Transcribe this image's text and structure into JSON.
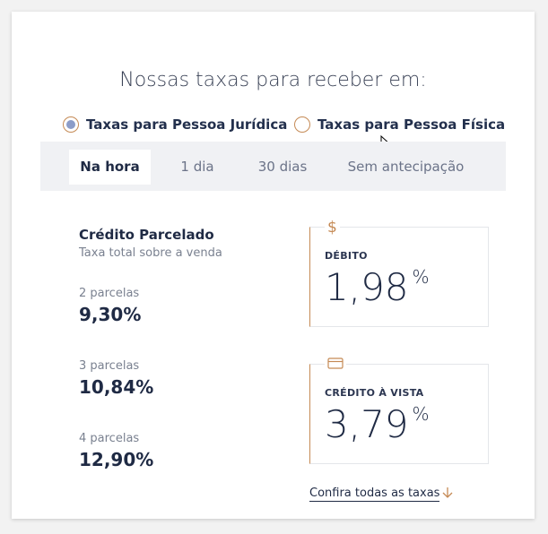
{
  "heading": "Nossas taxas para receber em:",
  "person_type": {
    "options": [
      {
        "label": "Taxas para Pessoa Jurídica",
        "selected": true
      },
      {
        "label": "Taxas para Pessoa Física",
        "selected": false
      }
    ]
  },
  "tabs": [
    {
      "label": "Na hora",
      "active": true
    },
    {
      "label": "1 dia",
      "active": false
    },
    {
      "label": "30 dias",
      "active": false
    },
    {
      "label": "Sem antecipação",
      "active": false
    }
  ],
  "credit_installments": {
    "title": "Crédito Parcelado",
    "subtitle": "Taxa total sobre a venda",
    "items": [
      {
        "label": "2 parcelas",
        "value": "9,30%"
      },
      {
        "label": "3 parcelas",
        "value": "10,84%"
      },
      {
        "label": "4 parcelas",
        "value": "12,90%"
      }
    ]
  },
  "debit": {
    "caption": "DÉBITO",
    "rate": "1,98",
    "unit": "%",
    "icon": "dollar-icon"
  },
  "credit_cash": {
    "caption": "CRÉDITO À VISTA",
    "rate": "3,79",
    "unit": "%",
    "icon": "credit-card-icon"
  },
  "link": {
    "label": "Confira todas as taxas",
    "icon": "arrow-down-icon"
  },
  "colors": {
    "accent": "#c58a55",
    "text": "#1f2a44",
    "radio_fill": "#8c9cc8"
  }
}
